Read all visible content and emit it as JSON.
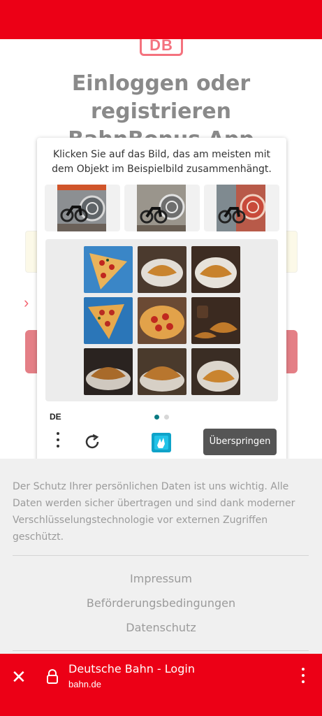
{
  "brand": {
    "logo_text": "DB",
    "accent": "#ec0016"
  },
  "page": {
    "heading_line1": "Einloggen oder registrieren",
    "heading_line2": "BahnBonus App"
  },
  "captcha": {
    "prompt": "Klicken Sie auf das Bild, das am meisten mit dem Objekt im Beispielbild zusammenhängt.",
    "example_images": [
      "motorcycle-example-1",
      "motorcycle-example-2",
      "motorcycle-example-3"
    ],
    "grid_tiles": [
      "pizza-art",
      "croissant",
      "croissant",
      "pizza-art",
      "pizza",
      "coffee-croissant",
      "croissant",
      "croissant",
      "croissant"
    ],
    "language": "DE",
    "page_indicator": {
      "current": 1,
      "total": 2
    },
    "skip_label": "Überspringen",
    "icons": {
      "menu": "more-vertical-icon",
      "refresh": "refresh-icon",
      "logo": "hcaptcha-logo-icon"
    }
  },
  "footer": {
    "privacy_text": "Der Schutz Ihrer persönlichen Daten ist uns wichtig. Alle Daten werden sicher übertragen und sind dank moderner Verschlüsselungstechnologie vor externen Zugriffen geschützt.",
    "links": [
      "Impressum",
      "Beförderungsbedingungen",
      "Datenschutz"
    ]
  },
  "browser_bar": {
    "title": "Deutsche Bahn - Login",
    "url": "bahn.de",
    "icons": {
      "close": "close-icon",
      "lock": "lock-icon",
      "menu": "more-vertical-icon"
    }
  }
}
